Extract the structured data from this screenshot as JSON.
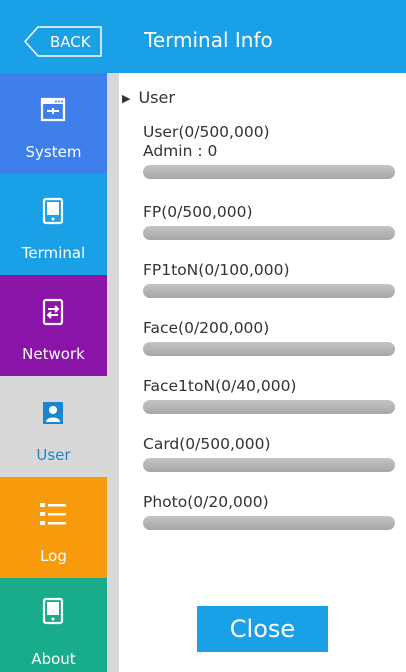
{
  "header": {
    "back_label": "BACK",
    "title": "Terminal Info"
  },
  "sidebar": {
    "items": [
      {
        "label": "System",
        "icon": "system-icon",
        "color": "#3f7fec",
        "active": false
      },
      {
        "label": "Terminal",
        "icon": "terminal-icon",
        "color": "#1aa0e6",
        "active": false
      },
      {
        "label": "Network",
        "icon": "network-icon",
        "color": "#8a13a8",
        "active": false
      },
      {
        "label": "User",
        "icon": "user-icon",
        "color": "#d8d8d8",
        "active": true
      },
      {
        "label": "Log",
        "icon": "log-icon",
        "color": "#f79a0b",
        "active": false
      },
      {
        "label": "About",
        "icon": "about-icon",
        "color": "#18ac8a",
        "active": false
      }
    ]
  },
  "content": {
    "section_title": "User",
    "stats": [
      {
        "label": "User(0/500,000)",
        "sub": "Admin : 0",
        "used": 0,
        "capacity": 500000
      },
      {
        "label": "FP(0/500,000)",
        "used": 0,
        "capacity": 500000
      },
      {
        "label": "FP1toN(0/100,000)",
        "used": 0,
        "capacity": 100000
      },
      {
        "label": "Face(0/200,000)",
        "used": 0,
        "capacity": 200000
      },
      {
        "label": "Face1toN(0/40,000)",
        "used": 0,
        "capacity": 40000
      },
      {
        "label": "Card(0/500,000)",
        "used": 0,
        "capacity": 500000
      },
      {
        "label": "Photo(0/20,000)",
        "used": 0,
        "capacity": 20000
      }
    ],
    "close_label": "Close"
  },
  "colors": {
    "accent": "#1aa0e6",
    "bar": "#b0b0b0",
    "divider": "#d8d8d8"
  }
}
